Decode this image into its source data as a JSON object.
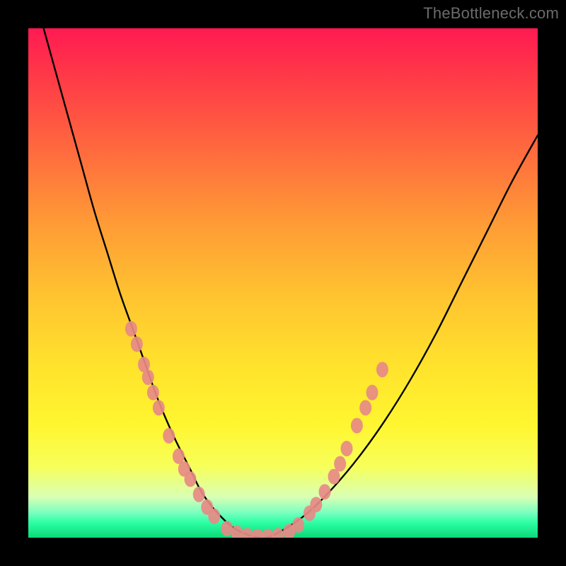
{
  "watermark": "TheBottleneck.com",
  "chart_data": {
    "type": "line",
    "title": "",
    "xlabel": "",
    "ylabel": "",
    "xlim": [
      0,
      100
    ],
    "ylim": [
      0,
      100
    ],
    "series": [
      {
        "name": "bottleneck-curve",
        "x": [
          3,
          5.5,
          8,
          10.5,
          13,
          15.5,
          18,
          20.5,
          23,
          25.5,
          28.5,
          31.5,
          34,
          37,
          41,
          46,
          50,
          55,
          60,
          65,
          70,
          75,
          80,
          85,
          90,
          95,
          100
        ],
        "values": [
          100,
          91,
          82,
          73,
          64,
          56,
          48,
          41,
          34,
          27,
          20,
          14,
          9,
          5,
          1.5,
          0,
          1.5,
          5,
          10,
          16,
          23,
          31,
          40,
          50,
          60,
          70,
          79
        ]
      }
    ],
    "markers": {
      "name": "highlight-dots",
      "color": "#e78a85",
      "points": [
        {
          "x": 20.2,
          "y": 41
        },
        {
          "x": 21.3,
          "y": 38
        },
        {
          "x": 22.7,
          "y": 34
        },
        {
          "x": 23.5,
          "y": 31.5
        },
        {
          "x": 24.5,
          "y": 28.5
        },
        {
          "x": 25.6,
          "y": 25.5
        },
        {
          "x": 27.6,
          "y": 20
        },
        {
          "x": 29.5,
          "y": 16
        },
        {
          "x": 30.6,
          "y": 13.5
        },
        {
          "x": 31.8,
          "y": 11.5
        },
        {
          "x": 33.5,
          "y": 8.5
        },
        {
          "x": 35.1,
          "y": 6.0
        },
        {
          "x": 36.5,
          "y": 4.2
        },
        {
          "x": 39.0,
          "y": 1.8
        },
        {
          "x": 41.0,
          "y": 0.9
        },
        {
          "x": 43.0,
          "y": 0.4
        },
        {
          "x": 45.0,
          "y": 0.2
        },
        {
          "x": 47.0,
          "y": 0.2
        },
        {
          "x": 49.0,
          "y": 0.4
        },
        {
          "x": 51.2,
          "y": 1.2
        },
        {
          "x": 53.0,
          "y": 2.5
        },
        {
          "x": 55.2,
          "y": 4.8
        },
        {
          "x": 56.5,
          "y": 6.5
        },
        {
          "x": 58.2,
          "y": 9.0
        },
        {
          "x": 60.0,
          "y": 12.0
        },
        {
          "x": 61.2,
          "y": 14.5
        },
        {
          "x": 62.5,
          "y": 17.5
        },
        {
          "x": 64.5,
          "y": 22
        },
        {
          "x": 66.2,
          "y": 25.5
        },
        {
          "x": 67.5,
          "y": 28.5
        },
        {
          "x": 69.5,
          "y": 33
        }
      ]
    }
  }
}
